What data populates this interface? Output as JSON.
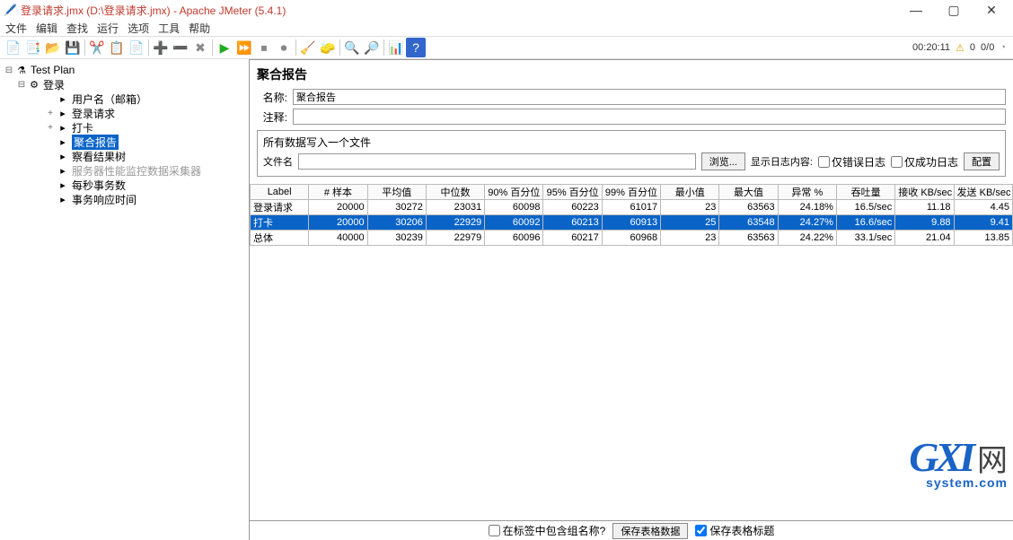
{
  "window": {
    "title": "登录请求.jmx (D:\\登录请求.jmx) - Apache JMeter (5.4.1)"
  },
  "menu": [
    "文件",
    "编辑",
    "查找",
    "运行",
    "选项",
    "工具",
    "帮助"
  ],
  "status": {
    "timer": "00:20:11",
    "warn_count": "0",
    "err_count": "0/0"
  },
  "tree": {
    "root": "Test Plan",
    "group": "登录",
    "items": [
      {
        "label": "用户名（邮箱）",
        "indent": 48
      },
      {
        "label": "登录请求",
        "indent": 48,
        "expander": "+"
      },
      {
        "label": "打卡",
        "indent": 48,
        "expander": "+"
      },
      {
        "label": "聚合报告",
        "indent": 48,
        "selected": true
      },
      {
        "label": "察看结果树",
        "indent": 48
      },
      {
        "label": "服务器性能监控数据采集器",
        "indent": 48,
        "muted": true
      },
      {
        "label": "每秒事务数",
        "indent": 48
      },
      {
        "label": "事务响应时间",
        "indent": 48
      }
    ]
  },
  "panel": {
    "title": "聚合报告",
    "name_label": "名称:",
    "name_value": "聚合报告",
    "comment_label": "注释:",
    "file_section": "所有数据写入一个文件",
    "file_label": "文件名",
    "browse": "浏览...",
    "log_label": "显示日志内容:",
    "only_err": "仅错误日志",
    "only_ok": "仅成功日志",
    "config": "配置"
  },
  "table": {
    "headers": [
      "Label",
      "# 样本",
      "平均值",
      "中位数",
      "90% 百分位",
      "95% 百分位",
      "99% 百分位",
      "最小值",
      "最大值",
      "异常 %",
      "吞吐量",
      "接收 KB/sec",
      "发送 KB/sec"
    ],
    "rows": [
      {
        "c": [
          "登录请求",
          "20000",
          "30272",
          "23031",
          "60098",
          "60223",
          "61017",
          "23",
          "63563",
          "24.18%",
          "16.5/sec",
          "11.18",
          "4.45"
        ]
      },
      {
        "c": [
          "打卡",
          "20000",
          "30206",
          "22929",
          "60092",
          "60213",
          "60913",
          "25",
          "63548",
          "24.27%",
          "16.6/sec",
          "9.88",
          "9.41"
        ],
        "selected": true
      },
      {
        "c": [
          "总体",
          "40000",
          "30239",
          "22979",
          "60096",
          "60217",
          "60968",
          "23",
          "63563",
          "24.22%",
          "33.1/sec",
          "21.04",
          "13.85"
        ]
      }
    ]
  },
  "bottom": {
    "include_group": "在标签中包含组名称?",
    "save_data": "保存表格数据",
    "save_header": "保存表格标题"
  },
  "watermark": {
    "brand": "GXI",
    "wang": "网",
    "sub": "system.com"
  }
}
